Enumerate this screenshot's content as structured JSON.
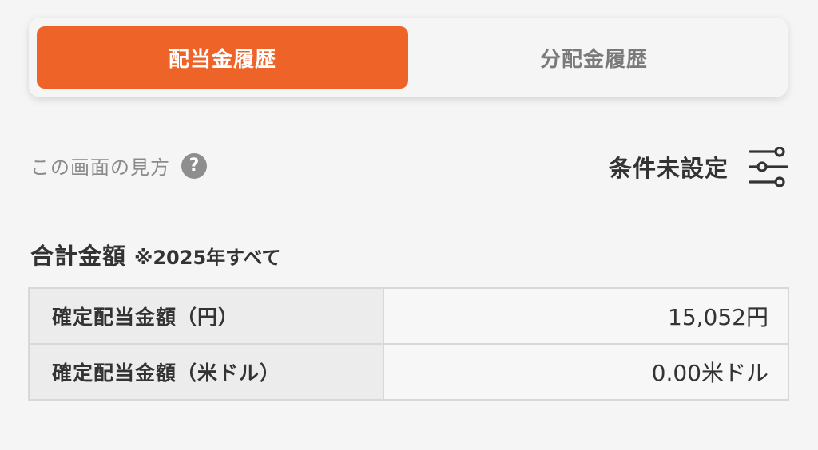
{
  "tabs": [
    {
      "label": "配当金履歴",
      "active": true
    },
    {
      "label": "分配金履歴",
      "active": false
    }
  ],
  "help": {
    "label": "この画面の見方",
    "icon": "question-circle-icon",
    "icon_glyph": "?"
  },
  "filter": {
    "label": "条件未設定",
    "icon": "sliders-icon"
  },
  "total": {
    "title": "合計金額",
    "period": "※2025年すべて"
  },
  "summary_rows": [
    {
      "label": "確定配当金額（円）",
      "value": "15,052円"
    },
    {
      "label": "確定配当金額（米ドル）",
      "value": "0.00米ドル"
    }
  ],
  "colors": {
    "accent": "#ee6428",
    "background": "#f5f5f5",
    "label_cell": "#ececec",
    "border": "#d8d8d8"
  }
}
